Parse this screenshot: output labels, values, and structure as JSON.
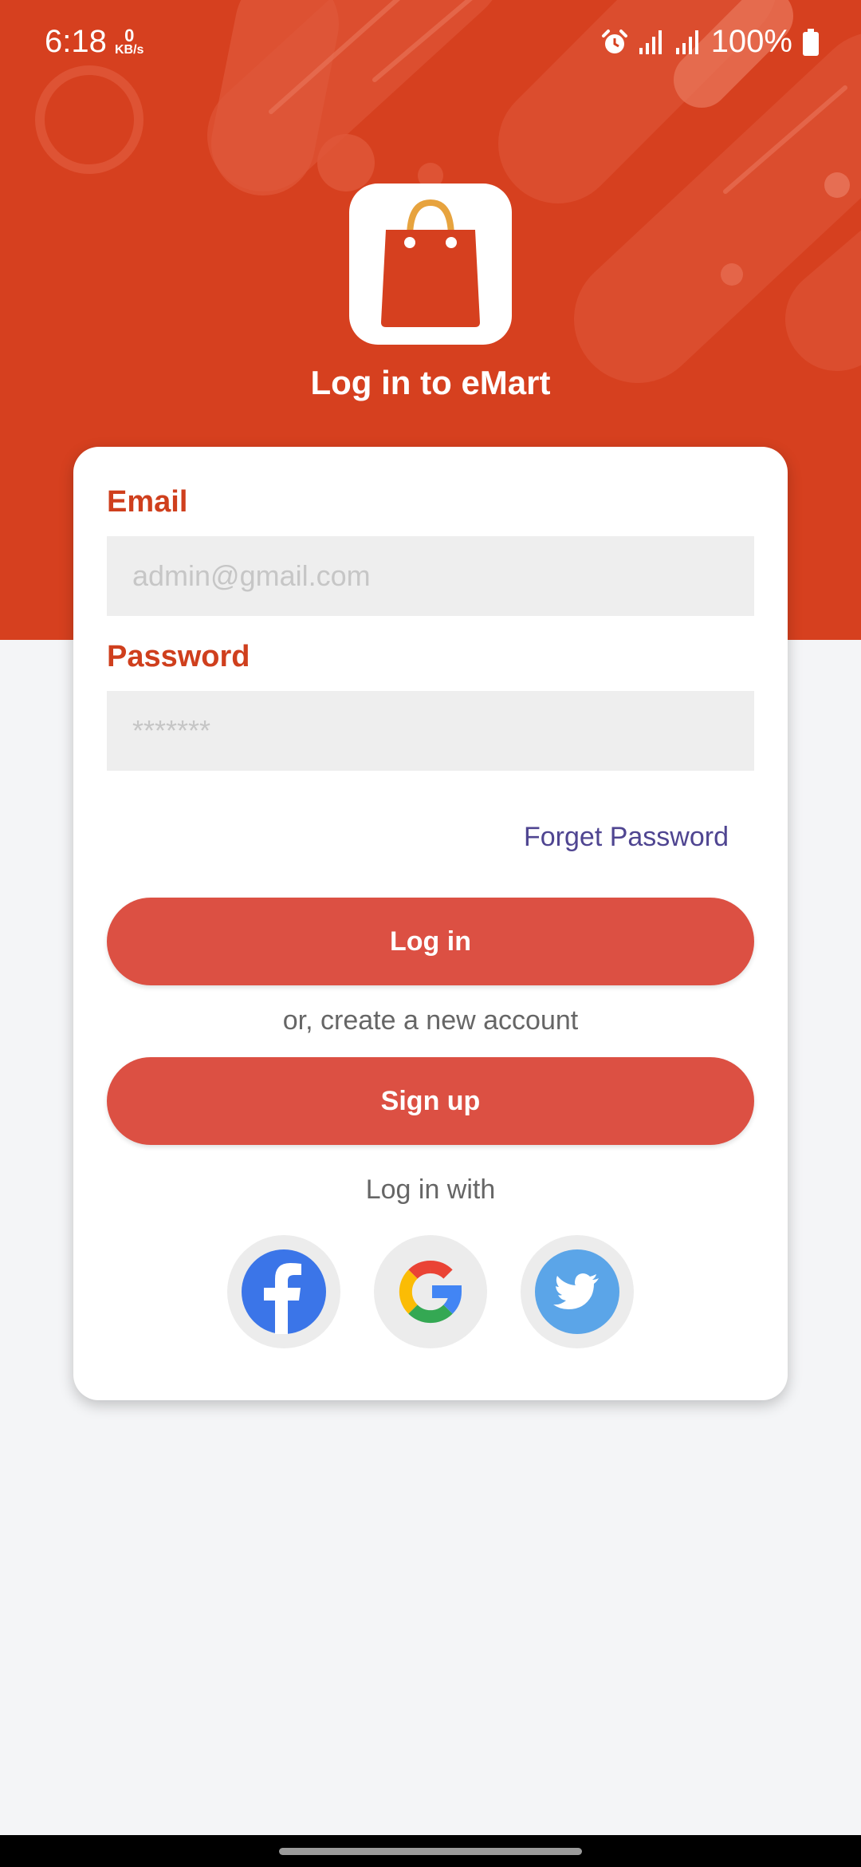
{
  "status_bar": {
    "time": "6:18",
    "net_speed_value": "0",
    "net_speed_unit": "KB/s",
    "battery": "100%",
    "icons": [
      "alarm-icon",
      "signal-icon",
      "signal-icon",
      "battery-icon"
    ]
  },
  "header": {
    "title": "Log in to eMart",
    "logo_icon": "shopping-bag-icon",
    "background_color": "#d6401f"
  },
  "form": {
    "email_label": "Email",
    "email_placeholder": "admin@gmail.com",
    "email_value": "",
    "password_label": "Password",
    "password_placeholder": "*******",
    "password_value": "",
    "forgot_password": "Forget Password",
    "login_button": "Log in",
    "create_account_text": "or, create a new account",
    "signup_button": "Sign up",
    "login_with_text": "Log in with"
  },
  "social": [
    {
      "name": "Facebook",
      "icon": "facebook-icon",
      "color": "#3b75e8"
    },
    {
      "name": "Google",
      "icon": "google-icon",
      "color": "#4285f4"
    },
    {
      "name": "Twitter",
      "icon": "twitter-icon",
      "color": "#5ba5e8"
    }
  ],
  "colors": {
    "accent": "#cf3f1d",
    "button": "#dc5043",
    "link": "#4f4591"
  }
}
